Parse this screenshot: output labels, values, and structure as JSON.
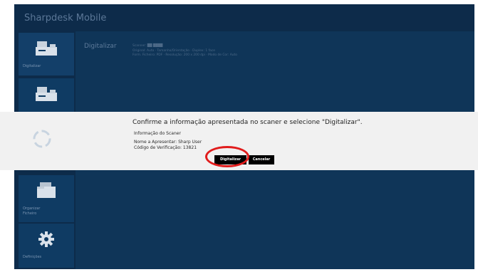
{
  "app": {
    "title": "Sharpdesk Mobile"
  },
  "sidebar": {
    "items": [
      {
        "label": "Digitalizar",
        "icon": "scanner-icon"
      },
      {
        "label": "",
        "icon": "scanner-icon"
      },
      {
        "label": "Organizar Ficheiro",
        "icon": "folder-icon"
      },
      {
        "label": "Definições",
        "icon": "gear-icon"
      }
    ]
  },
  "main": {
    "title": "Digitalizar",
    "details": [
      "Scanner:  ██  ████",
      "Original: Auto · Tamanho/Orientação · Duplex: 1 face",
      "Form. Ficheiro: PDF · Resolução: 200 x 200 dpi · Modo de Cor: Auto"
    ]
  },
  "dialog": {
    "heading": "Confirme a informação apresentada no scaner e selecione \"Digitalizar\".",
    "info_label": "Informação do Scaner",
    "name_line": "Nome a Apresentar: Sharp User",
    "code_line": "Código de Verificação: 13821",
    "scan_button": "Digitalizar",
    "cancel_button": "Cancelar"
  },
  "colors": {
    "background": "#0d2b4a",
    "panel": "#0f3558",
    "tile": "#0f3b63",
    "dialog": "#f1f1f1",
    "highlight": "#e11c1c"
  }
}
